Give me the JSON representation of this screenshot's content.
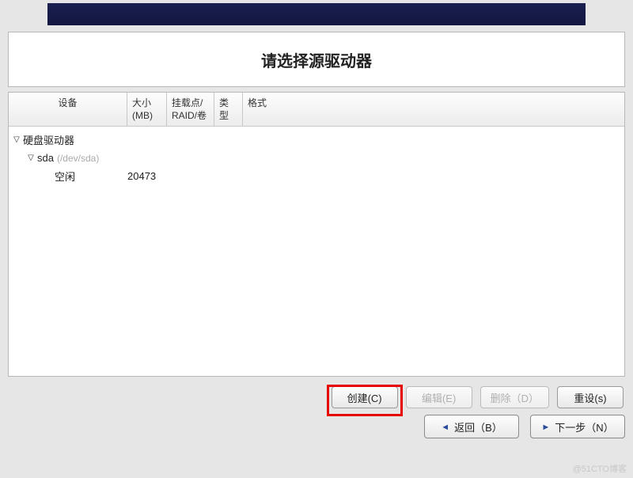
{
  "header": {
    "title": "请选择源驱动器"
  },
  "columns": {
    "device": "设备",
    "size": "大小\n(MB)",
    "mount": "挂载点/\nRAID/卷",
    "type": "类型",
    "format": "格式"
  },
  "tree": {
    "root_label": "硬盘驱动器",
    "sda_label": "sda",
    "sda_path": "(/dev/sda)",
    "free_label": "空闲",
    "free_size": "20473"
  },
  "buttons": {
    "create": "创建(C)",
    "edit": "编辑(E)",
    "delete": "删除（D）",
    "reset": "重设(s)",
    "back": "返回（B）",
    "next": "下一步（N）"
  },
  "watermark": "@51CTO博客"
}
